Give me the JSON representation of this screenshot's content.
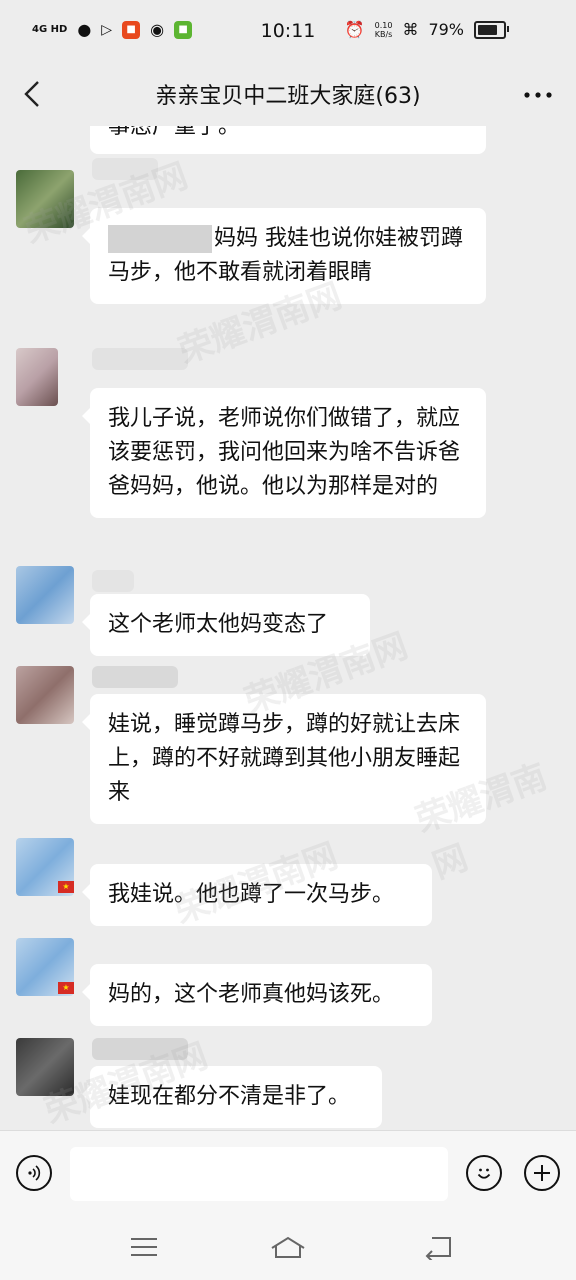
{
  "status_bar": {
    "network": "4G HD",
    "time": "10:11",
    "speed_value": "0.10",
    "speed_unit": "KB/s",
    "battery": "79%",
    "battery_level": 0.79
  },
  "header": {
    "title": "亲亲宝贝中二班大家庭(63)"
  },
  "messages": [
    {
      "text": "事态广重了。"
    },
    {
      "prefix_blurred": true,
      "text": "妈妈  我娃也说你娃被罚蹲马步，他不敢看就闭着眼睛"
    },
    {
      "text": "我儿子说，老师说你们做错了，就应该要惩罚，我问他回来为啥不告诉爸爸妈妈，他说。他以为那样是对的"
    },
    {
      "text": "这个老师太他妈变态了"
    },
    {
      "text": "娃说，睡觉蹲马步，蹲的好就让去床上，蹲的不好就蹲到其他小朋友睡起来"
    },
    {
      "text": "我娃说。他也蹲了一次马步。"
    },
    {
      "text": "妈的，这个老师真他妈该死。"
    },
    {
      "text": "娃现在都分不清是非了。"
    }
  ],
  "watermark": "荣耀渭南网",
  "colors": {
    "background": "#ededed",
    "bubble": "#ffffff",
    "text": "#111111"
  }
}
